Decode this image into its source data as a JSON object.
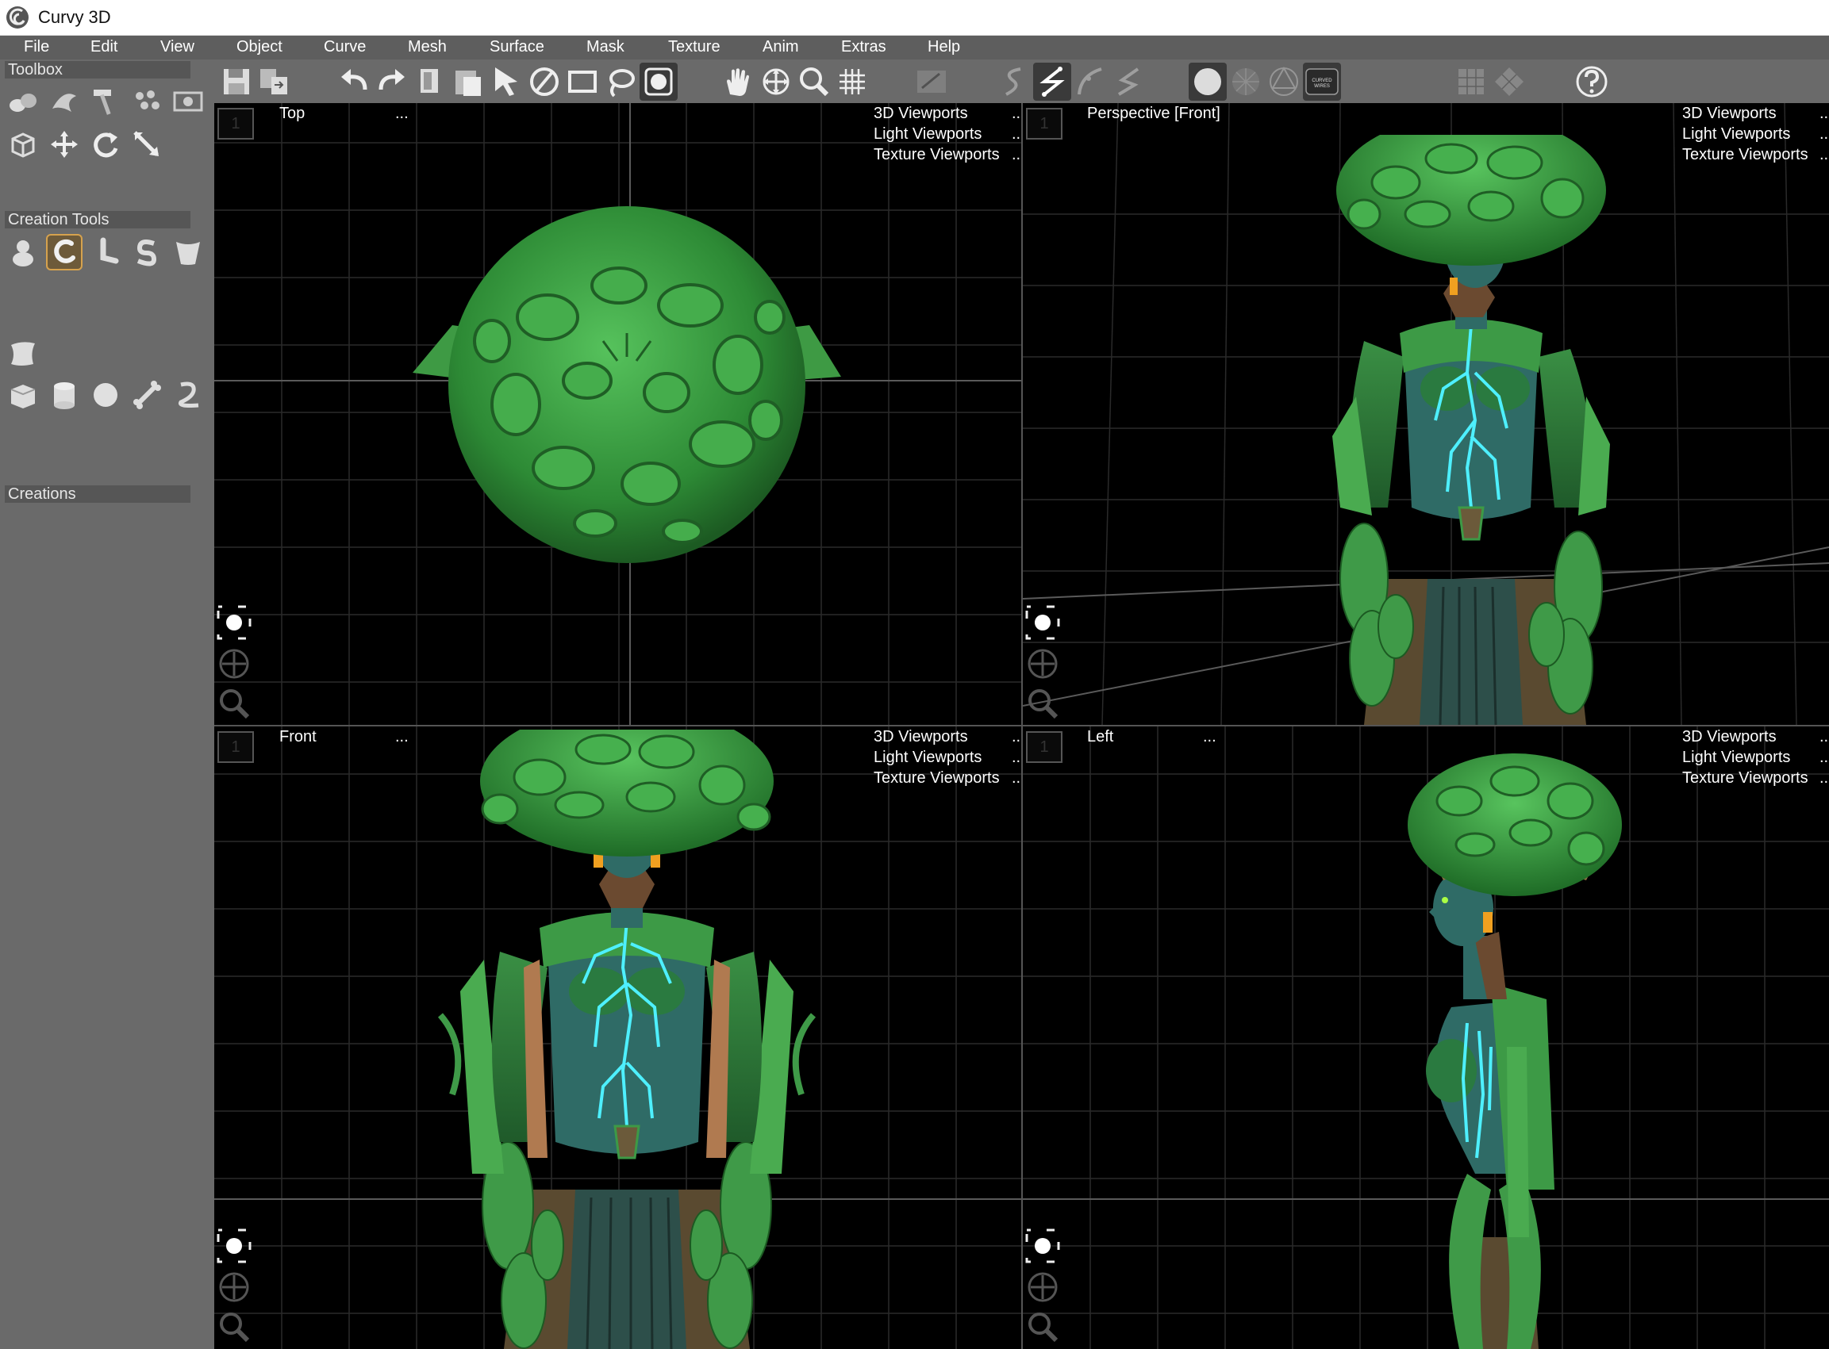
{
  "window": {
    "title": "Curvy 3D"
  },
  "menu": [
    "File",
    "Edit",
    "View",
    "Object",
    "Curve",
    "Mesh",
    "Surface",
    "Mask",
    "Texture",
    "Anim",
    "Extras",
    "Help"
  ],
  "left_panel": {
    "toolbox_label": "Toolbox",
    "creation_tools_label": "Creation Tools",
    "creations_label": "Creations"
  },
  "viewports": {
    "top_left": {
      "name": "Top",
      "more": "...",
      "menu": [
        "3D Viewports",
        "Light Viewports",
        "Texture Viewports"
      ],
      "menu_more": "...",
      "number": "1"
    },
    "top_right": {
      "name": "Perspective [Front]",
      "more": "",
      "menu": [
        "3D Viewports",
        "Light Viewports",
        "Texture Viewports"
      ],
      "menu_more": "...",
      "number": "1"
    },
    "bottom_left": {
      "name": "Front",
      "more": "...",
      "menu": [
        "3D Viewports",
        "Light Viewports",
        "Texture Viewports"
      ],
      "menu_more": "...",
      "number": "1"
    },
    "bottom_right": {
      "name": "Left",
      "more": "...",
      "menu": [
        "3D Viewports",
        "Light Viewports",
        "Texture Viewports"
      ],
      "menu_more": "...",
      "number": "1"
    }
  },
  "toolbar": {
    "curved_wires_label": "CURVED WIRES"
  },
  "colors": {
    "panel": "#6a6a6a",
    "menubar": "#5e5e5e",
    "selected_tool": "#d6a24e",
    "model_green": "#3f9a43",
    "glow": "#4ef0ff",
    "skin": "#2f6b66"
  }
}
